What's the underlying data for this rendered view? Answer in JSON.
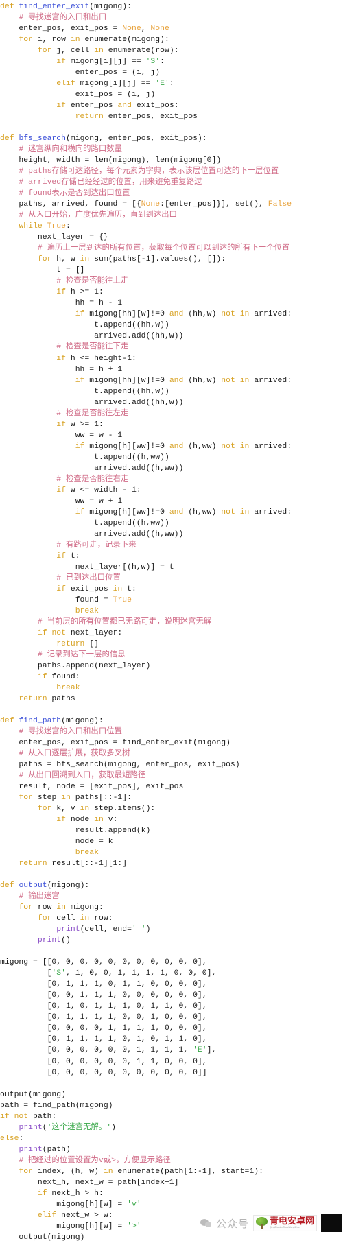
{
  "document": {
    "kind": "python-source-listing",
    "language": "Python",
    "background_color": "#ffffff",
    "text_color": "#1a1a1a"
  },
  "colors": {
    "keyword": "#d8a326",
    "function_name": "#3b4fd8",
    "builtin": "#8a4ec7",
    "string": "#3aa84a",
    "comment": "#d06a86",
    "constant": "#e8a33d"
  },
  "code": {
    "lines": [
      "def find_enter_exit(migong):",
      "    # 寻找迷宫的入口和出口",
      "    enter_pos, exit_pos = None, None",
      "    for i, row in enumerate(migong):",
      "        for j, cell in enumerate(row):",
      "            if migong[i][j] == 'S':",
      "                enter_pos = (i, j)",
      "            elif migong[i][j] == 'E':",
      "                exit_pos = (i, j)",
      "            if enter_pos and exit_pos:",
      "                return enter_pos, exit_pos",
      "",
      "def bfs_search(migong, enter_pos, exit_pos):",
      "    # 迷宫纵向和横向的路口数量",
      "    height, width = len(migong), len(migong[0])",
      "    # paths存储可达路径，每个元素为字典，表示该层位置可达的下一层位置",
      "    # arrived存储已经经过的位置，用来避免重复路过",
      "    # found表示是否到达出口位置",
      "    paths, arrived, found = [{None:[enter_pos]}], set(), False",
      "    # 从入口开始，广度优先遍历，直到到达出口",
      "    while True:",
      "        next_layer = {}",
      "        # 遍历上一层到达的所有位置，获取每个位置可以到达的所有下一个位置",
      "        for h, w in sum(paths[-1].values(), []):",
      "            t = []",
      "            # 检查是否能往上走",
      "            if h >= 1:",
      "                hh = h - 1",
      "                if migong[hh][w]!=0 and (hh,w) not in arrived:",
      "                    t.append((hh,w))",
      "                    arrived.add((hh,w))",
      "            # 检查是否能往下走",
      "            if h <= height-1:",
      "                hh = h + 1",
      "                if migong[hh][w]!=0 and (hh,w) not in arrived:",
      "                    t.append((hh,w))",
      "                    arrived.add((hh,w))",
      "            # 检查是否能往左走",
      "            if w >= 1:",
      "                ww = w - 1",
      "                if migong[h][ww]!=0 and (h,ww) not in arrived:",
      "                    t.append((h,ww))",
      "                    arrived.add((h,ww))",
      "            # 检查是否能往右走",
      "            if w <= width - 1:",
      "                ww = w + 1",
      "                if migong[h][ww]!=0 and (h,ww) not in arrived:",
      "                    t.append((h,ww))",
      "                    arrived.add((h,ww))",
      "            # 有路可走，记录下来",
      "            if t:",
      "                next_layer[(h,w)] = t",
      "            # 已到达出口位置",
      "            if exit_pos in t:",
      "                found = True",
      "                break",
      "        # 当前层的所有位置都已无路可走，说明迷宫无解",
      "        if not next_layer:",
      "            return []",
      "        # 记录到达下一层的信息",
      "        paths.append(next_layer)",
      "        if found:",
      "            break",
      "    return paths",
      "",
      "def find_path(migong):",
      "    # 寻找迷宫的入口和出口位置",
      "    enter_pos, exit_pos = find_enter_exit(migong)",
      "    # 从入口逐层扩展，获取多叉树",
      "    paths = bfs_search(migong, enter_pos, exit_pos)",
      "    # 从出口回溯到入口，获取最短路径",
      "    result, node = [exit_pos], exit_pos",
      "    for step in paths[::-1]:",
      "        for k, v in step.items():",
      "            if node in v:",
      "                result.append(k)",
      "                node = k",
      "                break",
      "    return result[::-1][1:]",
      "",
      "def output(migong):",
      "    # 输出迷宫",
      "    for row in migong:",
      "        for cell in row:",
      "            print(cell, end=' ')",
      "        print()",
      "",
      "migong = [[0, 0, 0, 0, 0, 0, 0, 0, 0, 0, 0],",
      "          ['S', 1, 0, 0, 1, 1, 1, 1, 0, 0, 0],",
      "          [0, 1, 1, 1, 0, 1, 1, 0, 0, 0, 0],",
      "          [0, 0, 1, 1, 1, 0, 0, 0, 0, 0, 0],",
      "          [0, 1, 0, 1, 1, 1, 0, 1, 1, 0, 0],",
      "          [0, 1, 1, 1, 1, 0, 0, 1, 0, 0, 0],",
      "          [0, 0, 0, 0, 1, 1, 1, 1, 0, 0, 0],",
      "          [0, 1, 1, 1, 1, 0, 1, 0, 1, 1, 0],",
      "          [0, 0, 0, 0, 0, 0, 1, 1, 1, 1, 'E'],",
      "          [0, 0, 0, 0, 0, 0, 1, 1, 0, 0, 0],",
      "          [0, 0, 0, 0, 0, 0, 0, 0, 0, 0, 0]]",
      "",
      "output(migong)",
      "path = find_path(migong)",
      "if not path:",
      "    print('这个迷宫无解。')",
      "else:",
      "    print(path)",
      "    # 把经过的位置设置为v或>，方便显示路径",
      "    for index, (h, w) in enumerate(path[1:-1], start=1):",
      "        next_h, next_w = path[index+1]",
      "        if next_h > h:",
      "            migong[h][w] = 'v'",
      "        elif next_w > w:",
      "            migong[h][w] = '>'",
      "    output(migong)"
    ],
    "tokens": {
      "keywords": [
        "def",
        "for",
        "in",
        "if",
        "elif",
        "else",
        "while",
        "and",
        "not",
        "return",
        "break"
      ],
      "constants": [
        "None",
        "True",
        "False"
      ],
      "builtins": [
        "print",
        "enumerate",
        "len",
        "set",
        "sum"
      ],
      "function_names": [
        "find_enter_exit",
        "bfs_search",
        "find_path",
        "output"
      ],
      "strings": [
        "'S'",
        "'E'",
        "'v'",
        "'>'",
        "' '",
        "'这个迷宫无解。'"
      ]
    }
  },
  "watermark": {
    "wechat_icon_name": "wechat-icon",
    "label": "公众号",
    "logo_title": "青电安卓网",
    "logo_sub": "QingDianAnZhuoWangZhan"
  }
}
